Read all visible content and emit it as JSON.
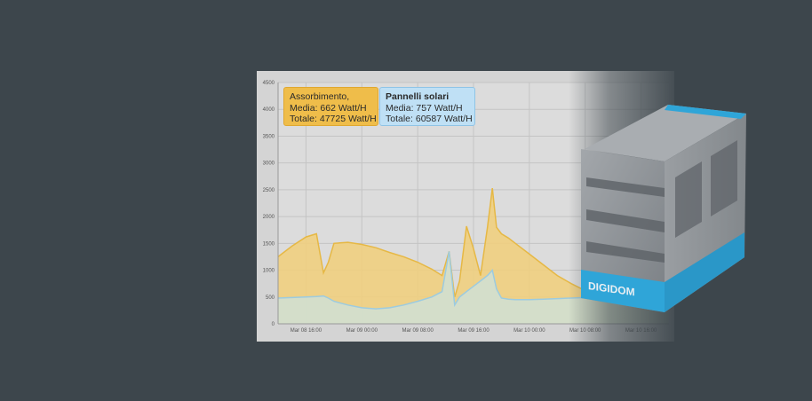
{
  "colors": {
    "background": "#3d464c",
    "plot_bg": "#dcdcdc",
    "absorption_fill": "#f0cf80",
    "absorption_line": "#e6b845",
    "solar_fill": "#cfe1d6",
    "solar_line": "#9ccbe0",
    "box_gray": "#8e9296",
    "box_blue": "#2fa5d8"
  },
  "tooltips": [
    {
      "title": "Assorbimento,",
      "media": "Media: 662 Watt/H",
      "totale": "Totale: 47725 Watt/H",
      "color": "#efbd4a"
    },
    {
      "title": "Pannelli solari",
      "media": "Media: 757 Watt/H",
      "totale": "Totale: 60587 Watt/H",
      "color": "#bfe0f5"
    }
  ],
  "product_box": {
    "brand": "DIGIDOM",
    "icon": "digidom-product-box"
  },
  "chart_data": {
    "type": "area",
    "x_tick_labels": [
      "Mar 08 16:00",
      "Mar 09 00:00",
      "Mar 09 08:00",
      "Mar 09 16:00",
      "Mar 10 00:00",
      "Mar 10 08:00",
      "Mar 10 16:00"
    ],
    "y_tick_labels": [
      "0",
      "500",
      "1000",
      "1500",
      "2000",
      "2500",
      "3000",
      "3500",
      "4000",
      "4500"
    ],
    "xlabel": "",
    "ylabel": "",
    "x_hours": [
      0,
      2,
      4,
      5.5,
      6.5,
      7.2,
      8,
      10,
      12,
      14,
      16,
      18,
      20,
      22,
      23.5,
      24.5,
      25.3,
      26,
      27,
      28,
      29,
      30,
      30.7,
      31.3,
      32,
      33,
      34,
      36,
      38,
      40,
      42,
      44,
      46,
      48,
      50,
      52,
      54,
      55,
      56
    ],
    "xlim": [
      0,
      56
    ],
    "ylim": [
      0,
      4500
    ],
    "grid": true,
    "legend": "none",
    "series": [
      {
        "name": "Assorbimento",
        "values": [
          1250,
          1450,
          1620,
          1680,
          950,
          1150,
          1500,
          1520,
          1480,
          1420,
          1330,
          1250,
          1150,
          1020,
          900,
          1350,
          500,
          800,
          1820,
          1400,
          900,
          1800,
          2530,
          1800,
          1680,
          1600,
          1500,
          1300,
          1100,
          900,
          750,
          620,
          550,
          500,
          520,
          510,
          520,
          520,
          520
        ],
        "color": "#f0cf80"
      },
      {
        "name": "Pannelli solari",
        "values": [
          480,
          490,
          500,
          510,
          520,
          480,
          420,
          350,
          300,
          280,
          300,
          350,
          420,
          500,
          600,
          1350,
          350,
          500,
          600,
          700,
          800,
          900,
          1000,
          650,
          480,
          460,
          450,
          450,
          460,
          470,
          480,
          490,
          500,
          500,
          700,
          1200,
          3700,
          3800,
          3800
        ],
        "color": "#cfe1d6"
      }
    ]
  }
}
